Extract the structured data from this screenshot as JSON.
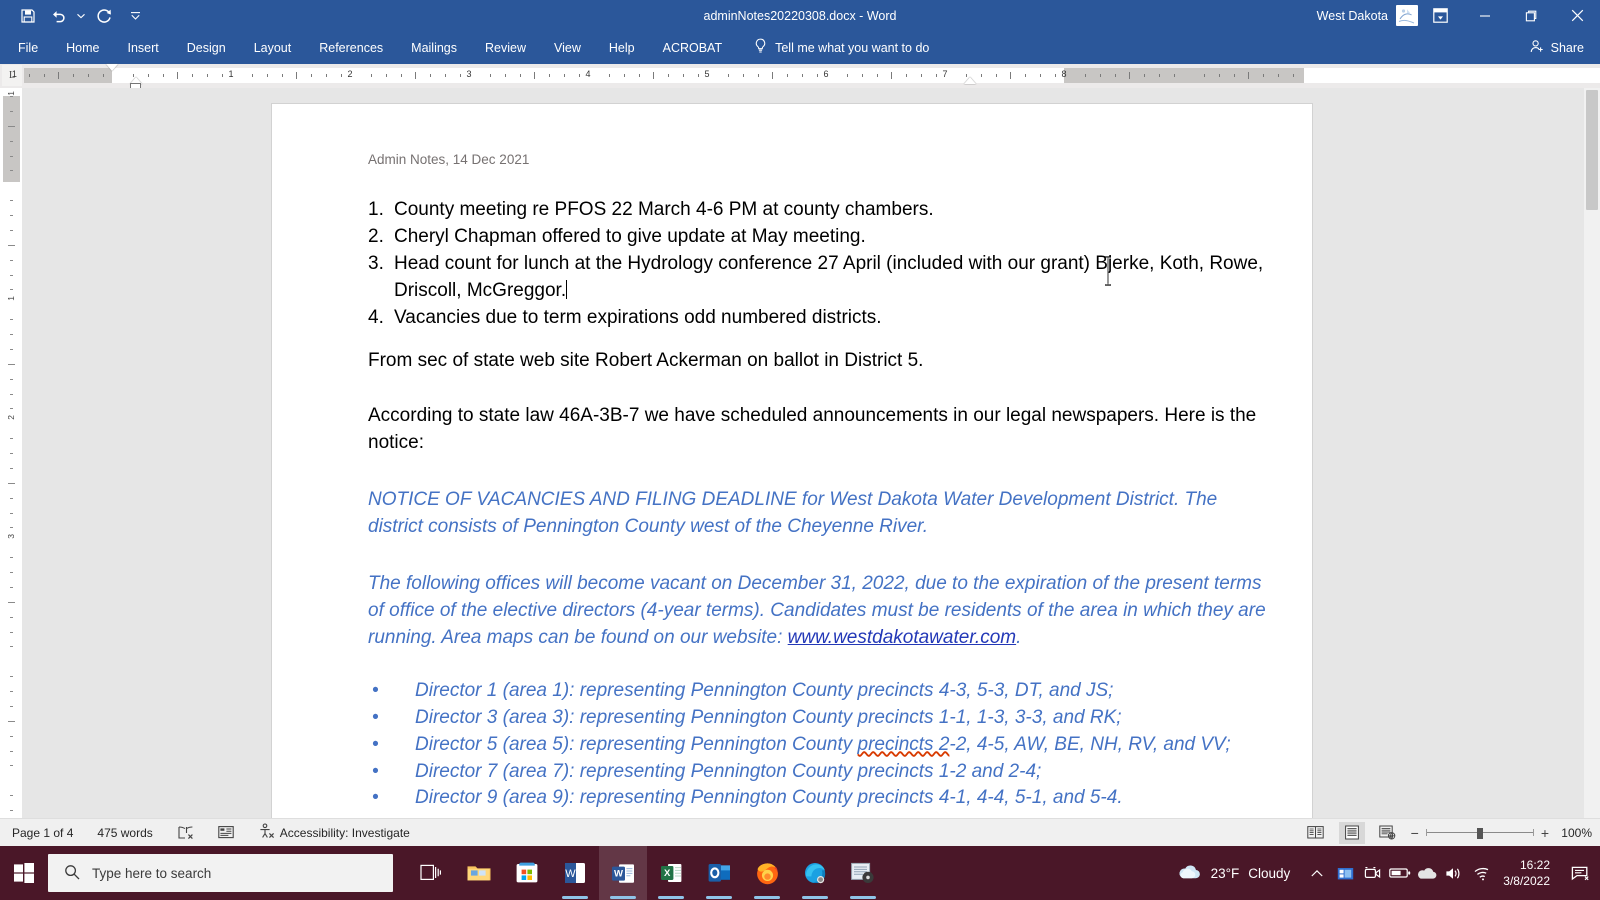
{
  "window": {
    "title": "adminNotes20220308.docx  -  Word",
    "account_name": "West Dakota",
    "quick_access": [
      {
        "name": "save",
        "label": "Save"
      },
      {
        "name": "undo",
        "label": "Undo"
      },
      {
        "name": "redo",
        "label": "Redo"
      },
      {
        "name": "customize",
        "label": "Customize Quick Access Toolbar"
      }
    ],
    "controls": {
      "ribbon_display": "Ribbon Display Options",
      "minimize": "Minimize",
      "restore": "Restore Down",
      "close": "Close"
    }
  },
  "ribbon": {
    "tabs": [
      {
        "label": "File"
      },
      {
        "label": "Home"
      },
      {
        "label": "Insert"
      },
      {
        "label": "Design"
      },
      {
        "label": "Layout"
      },
      {
        "label": "References"
      },
      {
        "label": "Mailings"
      },
      {
        "label": "Review"
      },
      {
        "label": "View"
      },
      {
        "label": "Help"
      },
      {
        "label": "ACROBAT"
      }
    ],
    "tell_me": "Tell me what you want to do",
    "share": "Share"
  },
  "ruler": {
    "tab_selector": "L",
    "horizontal_numbers": [
      "1",
      "1",
      "2",
      "3",
      "4",
      "5",
      "6",
      "7",
      "8"
    ],
    "vertical_numbers": [
      "1",
      "1",
      "2",
      "3"
    ]
  },
  "document": {
    "header": "Admin Notes, 14 Dec 2021",
    "numbered_list": [
      {
        "marker": "1.",
        "text": "County meeting re PFOS 22 March 4-6 PM at county chambers."
      },
      {
        "marker": "2.",
        "text": "Cheryl Chapman offered to give update at May meeting."
      },
      {
        "marker": "3.",
        "text": "Head count for lunch at the Hydrology conference 27 April (included with our grant) Bjerke, Koth, Rowe, Driscoll, McGreggor."
      },
      {
        "marker": "4.",
        "text": "Vacancies due to term expirations odd numbered districts."
      }
    ],
    "paragraph_1": "From sec of state web site Robert Ackerman on ballot in District 5.",
    "paragraph_2": "According to state law 46A-3B-7 we have scheduled announcements in our legal newspapers. Here is the notice:",
    "notice_1": "NOTICE OF VACANCIES AND FILING DEADLINE for West Dakota Water Development District. The district consists of Pennington County west of the Cheyenne River.",
    "notice_2_before_link": "The following offices will become vacant on December 31, 2022, due to the expiration of the present terms of office of the elective directors (4-year terms). Candidates must be residents of the area in which they are running. Area maps can be found on our website: ",
    "notice_2_link": "www.westdakotawater.com",
    "notice_2_after_link": ".",
    "bullets": [
      {
        "marker": "•",
        "text": "Director 1 (area 1): representing Pennington County precincts 4-3, 5-3, DT, and JS;"
      },
      {
        "marker": "•",
        "text": "Director 3 (area 3): representing Pennington County precincts 1-1, 1-3, 3-3, and RK;"
      },
      {
        "marker": "•",
        "text_before": "Director 5 (area 5): representing Pennington County ",
        "text_misspelled": "precincts 2",
        "text_after": "-2, 4-5, AW, BE, NH, RV, and VV;"
      },
      {
        "marker": "•",
        "text": "Director 7 (area 7): representing Pennington County precincts 1-2 and 2-4;"
      },
      {
        "marker": "•",
        "text": "Director 9 (area 9): representing Pennington County precincts 4-1, 4-4, 5-1, and 5-4."
      }
    ]
  },
  "status_bar": {
    "page": "Page 1 of 4",
    "words": "475 words",
    "proofing_icon": "proofing-errors-icon",
    "language_icon": "language-icon",
    "accessibility": "Accessibility: Investigate",
    "view_buttons": [
      {
        "name": "read-mode",
        "label": "Read Mode"
      },
      {
        "name": "print-layout",
        "label": "Print Layout"
      },
      {
        "name": "web-layout",
        "label": "Web Layout"
      }
    ],
    "zoom_out": "−",
    "zoom_in": "+",
    "zoom_level": "100%"
  },
  "taskbar": {
    "search_placeholder": "Type here to search",
    "apps": [
      {
        "name": "task-view",
        "label": "Task View"
      },
      {
        "name": "file-explorer",
        "label": "File Explorer"
      },
      {
        "name": "microsoft-store",
        "label": "Microsoft Store"
      },
      {
        "name": "word",
        "label": "Word"
      },
      {
        "name": "word-active",
        "label": "Word"
      },
      {
        "name": "excel",
        "label": "Excel"
      },
      {
        "name": "outlook",
        "label": "Outlook"
      },
      {
        "name": "firefox",
        "label": "Firefox"
      },
      {
        "name": "edge",
        "label": "Microsoft Edge"
      },
      {
        "name": "media-player",
        "label": "Media Player"
      }
    ],
    "weather_temp": "23°F",
    "weather_cond": "Cloudy",
    "time": "16:22",
    "date": "3/8/2022",
    "tray_icons": [
      {
        "name": "show-hidden-icons"
      },
      {
        "name": "meet-now-icon"
      },
      {
        "name": "camera-icon"
      },
      {
        "name": "battery-icon"
      },
      {
        "name": "onedrive-icon"
      },
      {
        "name": "volume-icon"
      },
      {
        "name": "network-icon"
      }
    ],
    "notification_icon": "notifications-icon"
  },
  "colors": {
    "word_blue": "#2b579a",
    "notice_blue": "#4472c4",
    "link_blue": "#2338b7",
    "taskbar": "#4a1728",
    "header_gray": "#767171",
    "spellcheck_red": "#d83b01"
  }
}
